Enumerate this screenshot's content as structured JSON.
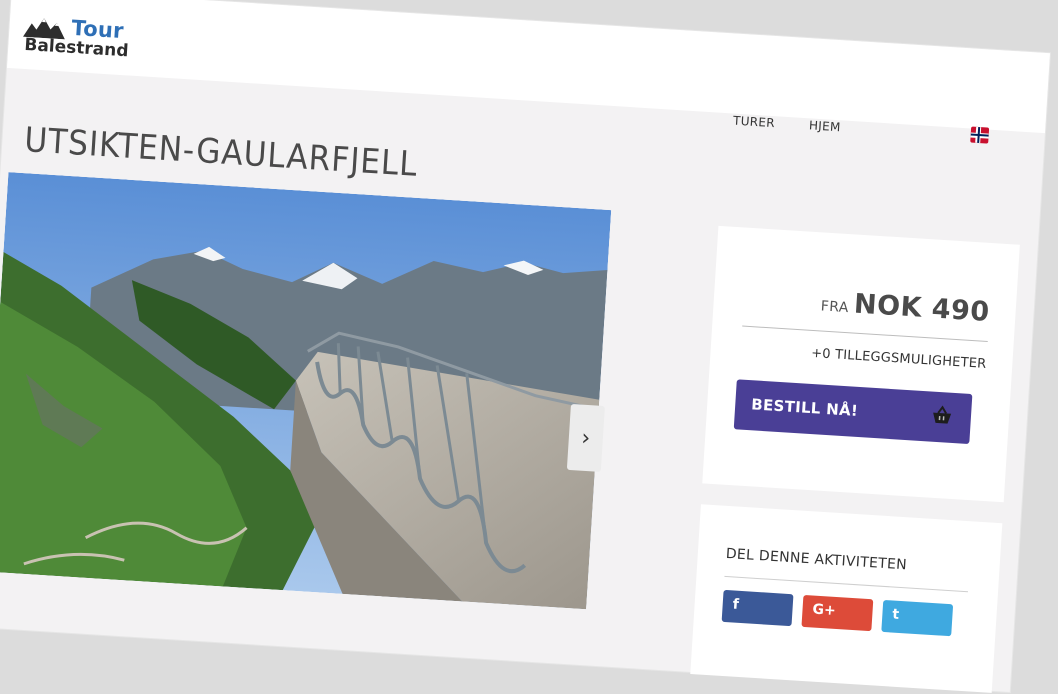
{
  "logo": {
    "line1": "Tour",
    "line2": "Balestrand"
  },
  "nav": {
    "items": [
      "TURER",
      "HJEM"
    ]
  },
  "page": {
    "title": "UTSIKTEN-GAULARFJELL"
  },
  "booking": {
    "price_prefix": "FRA",
    "price": "NOK 490",
    "extras": "+0 TILLEGGSMULIGHETER",
    "book_label": "BESTILL NÅ!"
  },
  "share": {
    "heading": "DEL DENNE AKTIVITETEN",
    "facebook": "f",
    "google": "G+",
    "twitter": "t"
  },
  "carousel": {
    "next_glyph": "›"
  },
  "colors": {
    "brand_blue": "#2e6fb6",
    "book_button": "#4a3f96",
    "facebook": "#3b5998",
    "google": "#dd4b39",
    "twitter": "#3fa9e0"
  },
  "icons": [
    "mountains-logo-icon",
    "norway-flag-icon",
    "chevron-right-icon",
    "basket-icon"
  ]
}
